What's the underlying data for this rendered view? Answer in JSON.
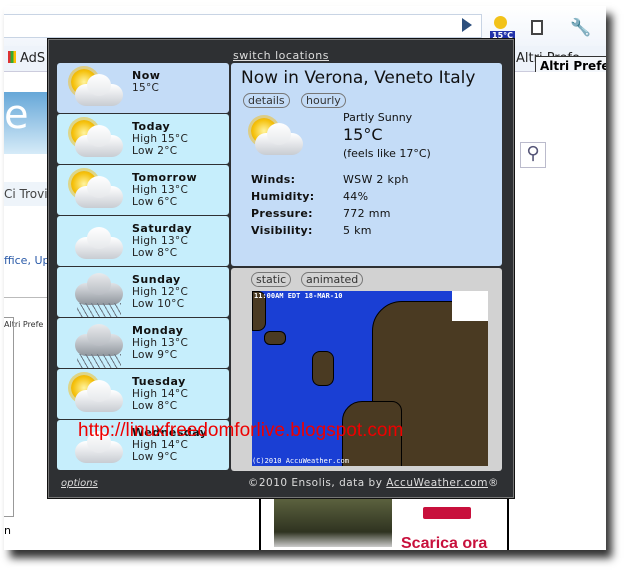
{
  "browser": {
    "bookmark_ads": "AdS",
    "bookmark_altri": "Altri Prefe",
    "tooltip": "Altri Prefe",
    "extension_badge": "15°C"
  },
  "background": {
    "logo_fragment": "e",
    "text1": "Ci Trovi",
    "text2": "ffice, Up",
    "mini_label": "Altri Prefe",
    "fragment_n": "n",
    "ad_text": "Scarica ora"
  },
  "popup": {
    "switch_locations": "switch locations",
    "forecast": [
      {
        "day": "Now",
        "line1": "15°C",
        "line2": "",
        "icon": "partly-sunny"
      },
      {
        "day": "Today",
        "line1": "High 15°C",
        "line2": "Low 2°C",
        "icon": "partly-sunny"
      },
      {
        "day": "Tomorrow",
        "line1": "High 13°C",
        "line2": "Low 6°C",
        "icon": "partly-sunny"
      },
      {
        "day": "Saturday",
        "line1": "High 13°C",
        "line2": "Low 8°C",
        "icon": "cloudy"
      },
      {
        "day": "Sunday",
        "line1": "High 12°C",
        "line2": "Low 10°C",
        "icon": "rain"
      },
      {
        "day": "Monday",
        "line1": "High 13°C",
        "line2": "Low 9°C",
        "icon": "rain"
      },
      {
        "day": "Tuesday",
        "line1": "High 14°C",
        "line2": "Low 8°C",
        "icon": "partly-sunny"
      },
      {
        "day": "Wednesday",
        "line1": "High 14°C",
        "line2": "Low 9°C",
        "icon": "cloudy"
      }
    ],
    "now": {
      "title": "Now in Verona, Veneto Italy",
      "details": "details",
      "hourly": "hourly",
      "condition": "Partly Sunny",
      "temp": "15°C",
      "feels": "(feels like 17°C)",
      "rows": [
        {
          "label": "Winds:",
          "value": "WSW 2 kph"
        },
        {
          "label": "Humidity:",
          "value": "44%"
        },
        {
          "label": "Pressure:",
          "value": "772 mm"
        },
        {
          "label": "Visibility:",
          "value": "5 km"
        }
      ]
    },
    "map": {
      "static": "static",
      "animated": "animated",
      "timestamp": "11:00AM EDT 18-MAR-10",
      "copyright": "(C)2010 AccuWeather.com"
    },
    "options": "options",
    "credit_prefix": "©2010 Ensolis, data by ",
    "credit_link": "AccuWeather.com",
    "credit_suffix": "®"
  },
  "watermark": "http://linuxfreedomforlive.blogspot.com"
}
